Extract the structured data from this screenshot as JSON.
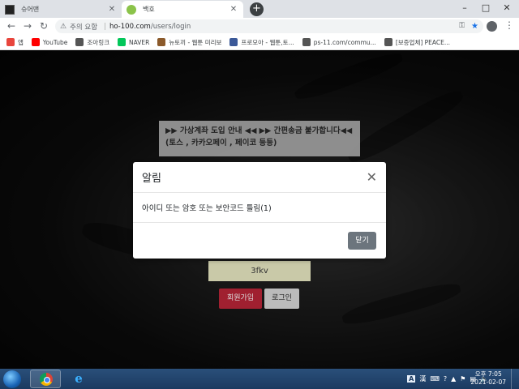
{
  "tabs": [
    {
      "title": "슈어맨",
      "active": false
    },
    {
      "title": "백호",
      "active": true
    }
  ],
  "toolbar": {
    "security_label": "주의 요함",
    "url_host": "ho-100.com",
    "url_path": "/users/login"
  },
  "bookmarks": [
    {
      "label": "앱",
      "icon": "apps-icon",
      "color": "#e8453c"
    },
    {
      "label": "YouTube",
      "icon": "youtube-icon",
      "color": "#ff0000"
    },
    {
      "label": "조아링크",
      "icon": "globe-icon",
      "color": "#555"
    },
    {
      "label": "NAVER",
      "icon": "naver-icon",
      "color": "#03c75a"
    },
    {
      "label": "뉴토끼 - 웹툰 미리보",
      "icon": "rabbit-icon",
      "color": "#8b5a2b"
    },
    {
      "label": "프로모아 - 웹툰,토...",
      "icon": "promoa-icon",
      "color": "#3b5998"
    },
    {
      "label": "ps-11.com/commu...",
      "icon": "globe-icon",
      "color": "#555"
    },
    {
      "label": "[보증업체] PEACE...",
      "icon": "globe-icon",
      "color": "#555"
    }
  ],
  "page": {
    "notice": "▶▶ 가상계좌 도입 안내 ◀◀ ▶▶ 간편송금 불가합니다◀◀ (토스 , 카카오페이 , 페이코 등등)",
    "captcha": "3fkv",
    "signup_label": "회원가입",
    "login_label": "로그인"
  },
  "modal": {
    "title": "알림",
    "message": "아이디 또는 암호 또는 보안코드 틀림(1)",
    "close_label": "닫기"
  },
  "taskbar": {
    "lang": "A",
    "ime": "漢",
    "time": "오후 7:05",
    "date": "2021-02-07"
  },
  "colors": {
    "signup_bg": "#a02030",
    "close_btn_bg": "#6c757d",
    "taskbar_bg": "#1b3a60"
  }
}
